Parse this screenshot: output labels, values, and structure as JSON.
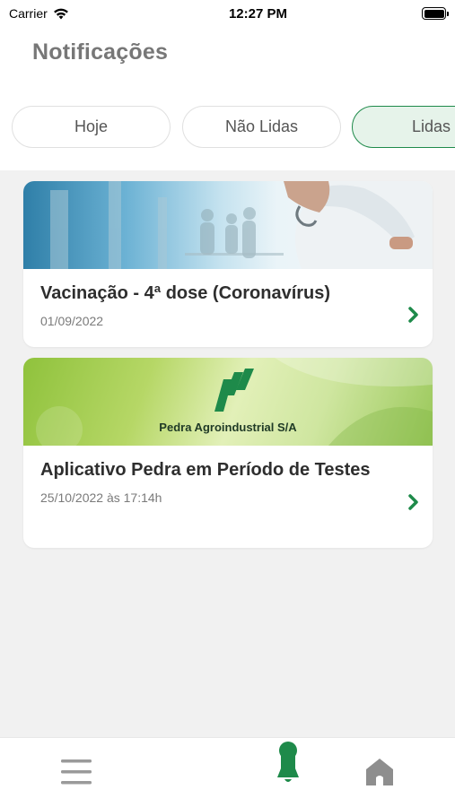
{
  "status_bar": {
    "carrier": "Carrier",
    "time": "12:27 PM",
    "icons": [
      "wifi-icon",
      "battery-icon"
    ]
  },
  "header": {
    "title": "Notificações"
  },
  "tabs": [
    {
      "label": "Hoje",
      "selected": false
    },
    {
      "label": "Não Lidas",
      "selected": false
    },
    {
      "label": "Lidas",
      "selected": true
    }
  ],
  "notifications": [
    {
      "title": "Vacinação - 4ª dose (Coronavírus)",
      "date": "01/09/2022",
      "image": "medical-staff-photo"
    },
    {
      "title": "Aplicativo Pedra em Período de Testes",
      "date": "25/10/2022 às 17:14h",
      "image": "pedra-banner",
      "image_caption": "Pedra Agroindustrial S/A"
    }
  ],
  "bottom_nav": {
    "items": [
      "menu-icon",
      "bell-icon",
      "home-icon"
    ],
    "active": "bell-icon"
  },
  "colors": {
    "accent": "#1e8a4a",
    "tab_selected_bg": "#e6f3ea",
    "title_gray": "#777777",
    "background": "#f1f1f1"
  }
}
